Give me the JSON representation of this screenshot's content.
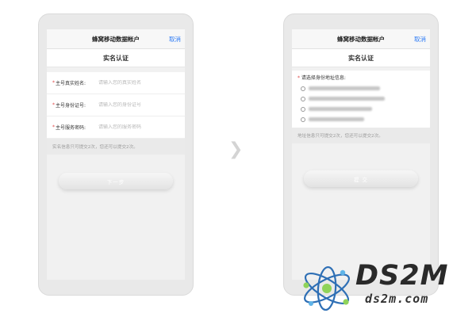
{
  "left_phone": {
    "nav_title": "蜂窝移动数据帐户",
    "cancel": "取消",
    "subtitle": "实名认证",
    "fields": [
      {
        "star": "*",
        "label": "主号真实姓名:",
        "placeholder": "请输入您的真实姓名"
      },
      {
        "star": "*",
        "label": "主号身份证号:",
        "placeholder": "请输入您的身份证号"
      },
      {
        "star": "*",
        "label": "主号服务密码:",
        "placeholder": "请输入您的服务密码"
      }
    ],
    "hint": "实名信息只可提交2次，您还可以提交2次。",
    "button": "下一步"
  },
  "right_phone": {
    "nav_title": "蜂窝移动数据帐户",
    "cancel": "取消",
    "subtitle": "实名认证",
    "address_heading_star": "*",
    "address_heading": "请选择身份地址信息:",
    "hint": "地址信息只可提交2次，您还可以提交2次。",
    "button": "提 交"
  },
  "watermark": {
    "brand": "DS2M",
    "url": "ds2m.com"
  },
  "colors": {
    "accent": "#2f7cf6",
    "required_star": "#e04646"
  },
  "icons": {
    "arrow": "chevron-right-icon",
    "logo": "atom-logo-icon"
  }
}
